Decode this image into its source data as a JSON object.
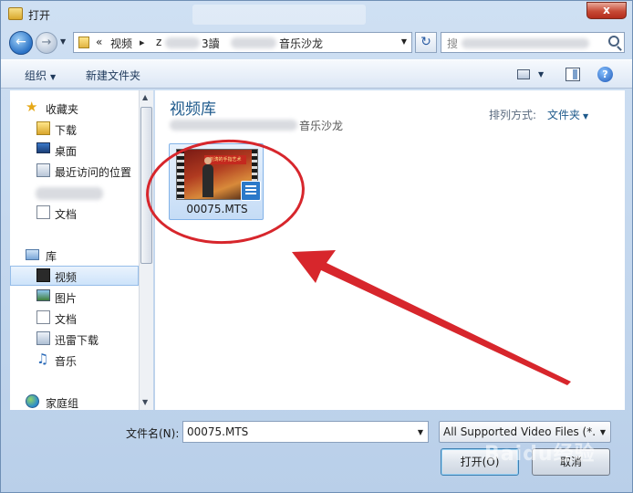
{
  "window": {
    "title": "打开",
    "close_label": "x"
  },
  "address": {
    "prefix": "«",
    "seg1": "视频",
    "seg2": "z",
    "seg3": "3讀",
    "seg4": "音乐沙龙"
  },
  "search": {
    "placeholder": "搜"
  },
  "toolbar": {
    "organize_label": "组织",
    "new_folder_label": "新建文件夹",
    "help_label": "?"
  },
  "sidebar": {
    "favorites_label": "收藏夹",
    "downloads_label": "下载",
    "desktop_label": "桌面",
    "recent_label": "最近访问的位置",
    "docs_label": "文档",
    "library_label": "库",
    "video_label": "视频",
    "pictures_label": "图片",
    "lib_docs_label": "文档",
    "xunlei_label": "迅雷下载",
    "music_label": "音乐",
    "homegroup_label": "家庭组"
  },
  "main": {
    "library_title": "视频库",
    "library_subtitle_tail": "音乐沙龙",
    "sort_label": "排列方式:",
    "sort_value": "文件夹",
    "file": {
      "name": "00075.MTS",
      "thumb_banner": "刘涛的手指艺术"
    }
  },
  "bottom": {
    "filename_label": "文件名(N):",
    "filename_value": "00075.MTS",
    "filter_value": "All Supported Video Files (*.",
    "open_label": "打开(O)",
    "cancel_label": "取消"
  },
  "watermark": "Baidu经验",
  "colors": {
    "annotation_red": "#d7262c",
    "library_title_blue": "#1e5a8c"
  }
}
